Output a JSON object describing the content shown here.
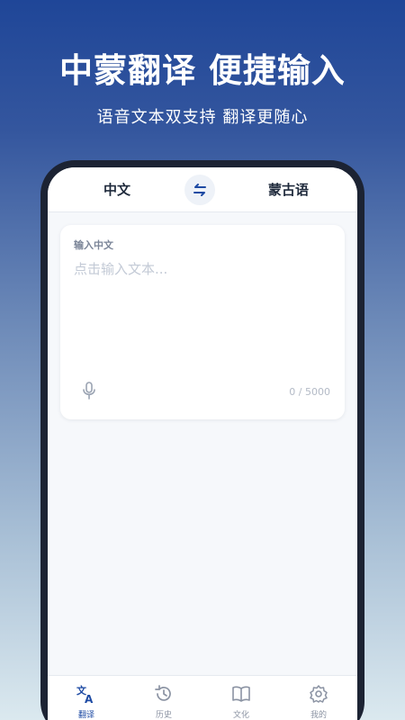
{
  "hero": {
    "title": "中蒙翻译 便捷输入",
    "subtitle": "语音文本双支持 翻译更随心"
  },
  "lang_bar": {
    "source": "中文",
    "target": "蒙古语",
    "swap_icon": "swap-arrows-icon"
  },
  "input_card": {
    "label": "输入中文",
    "placeholder": "点击输入文本...",
    "value": "",
    "counter": "0 / 5000",
    "mic_icon": "microphone-icon"
  },
  "tabs": [
    {
      "label": "翻译",
      "icon": "translate-icon",
      "active": true
    },
    {
      "label": "历史",
      "icon": "history-icon",
      "active": false
    },
    {
      "label": "文化",
      "icon": "book-icon",
      "active": false
    },
    {
      "label": "我的",
      "icon": "gear-icon",
      "active": false
    }
  ],
  "colors": {
    "accent": "#1d4aa3",
    "tab_inactive": "#8b93a3",
    "phone_frame": "#1c2333"
  }
}
